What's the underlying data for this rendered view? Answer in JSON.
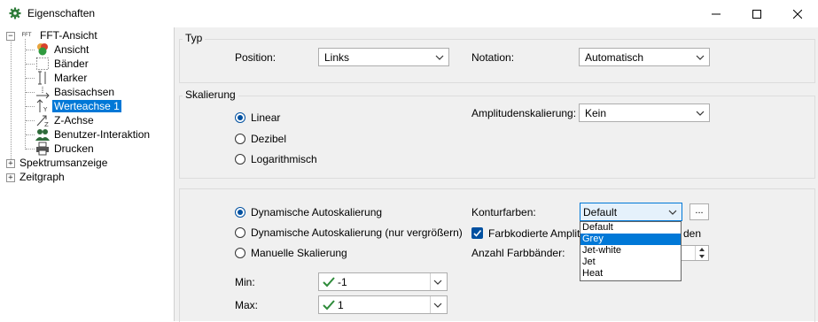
{
  "window": {
    "title": "Eigenschaften",
    "icon": "gear-icon",
    "controls": {
      "minimize": "minimize-icon",
      "maximize": "maximize-icon",
      "close": "close-icon"
    }
  },
  "tree": {
    "root": {
      "label": "FFT-Ansicht",
      "tag": "FFT"
    },
    "children": [
      {
        "label": "Ansicht",
        "icon": "palette-icon"
      },
      {
        "label": "Bänder",
        "icon": "bands-icon"
      },
      {
        "label": "Marker",
        "icon": "marker-icon"
      },
      {
        "label": "Basisachsen",
        "icon": "base-axis-icon"
      },
      {
        "label": "Werteachse 1",
        "icon": "value-axis-icon",
        "selected": true
      },
      {
        "label": "Z-Achse",
        "icon": "z-axis-icon"
      },
      {
        "label": "Benutzer-Interaktion",
        "icon": "users-icon"
      },
      {
        "label": "Drucken",
        "icon": "printer-icon"
      }
    ],
    "siblings": [
      {
        "label": "Spektrumsanzeige"
      },
      {
        "label": "Zeitgraph"
      }
    ]
  },
  "typ": {
    "title": "Typ",
    "position_label": "Position:",
    "position_value": "Links",
    "notation_label": "Notation:",
    "notation_value": "Automatisch"
  },
  "skalierung": {
    "title": "Skalierung",
    "options": [
      "Linear",
      "Dezibel",
      "Logarithmisch"
    ],
    "selected": "Linear",
    "amplitude_label": "Amplitudenskalierung:",
    "amplitude_value": "Kein"
  },
  "auto": {
    "options": [
      "Dynamische Autoskalierung",
      "Dynamische Autoskalierung (nur vergrößern)",
      "Manuelle Skalierung"
    ],
    "selected": "Dynamische Autoskalierung",
    "min_label": "Min:",
    "min_value": "-1",
    "max_label": "Max:",
    "max_value": "1",
    "kontur_label": "Konturfarben:",
    "kontur_value": "Default",
    "more_button": "...",
    "farbkodiert_label": "Farbkodierte Amplitude",
    "farbkodiert_suffix": "den",
    "farbkodiert_checked": true,
    "farbbaender_label": "Anzahl Farbbänder:",
    "dropdown_options": [
      "Default",
      "Grey",
      "Jet-white",
      "Jet",
      "Heat"
    ],
    "dropdown_highlight": "Grey"
  },
  "colors": {
    "accent": "#0078d7",
    "radio": "#0050a0",
    "check": "#2e8b3a"
  }
}
